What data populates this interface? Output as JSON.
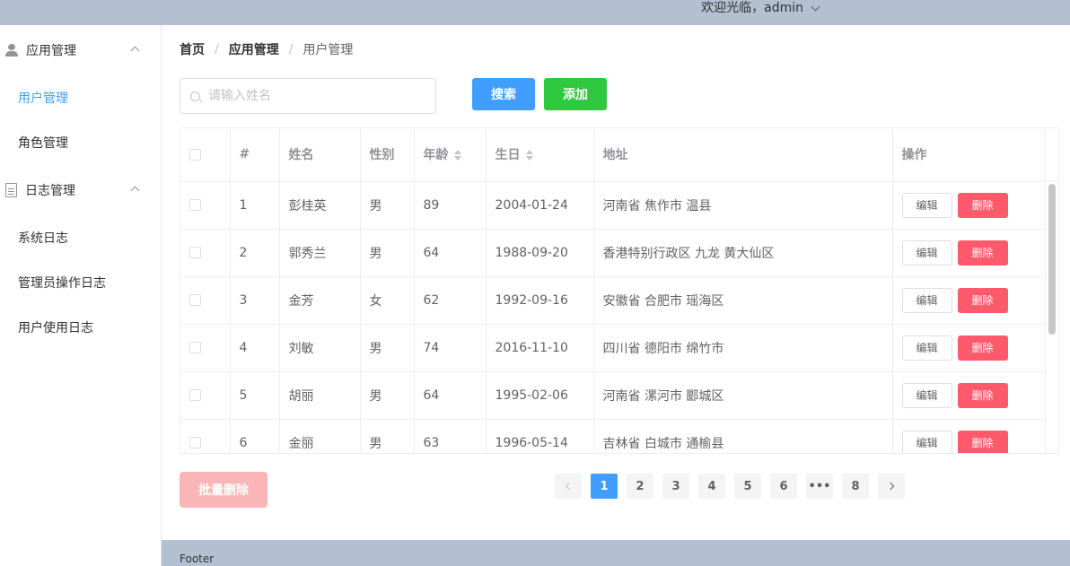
{
  "header": {
    "welcome": "欢迎光临，admin"
  },
  "sidebar": {
    "groups": [
      {
        "label": "应用管理",
        "icon": "user-icon",
        "items": [
          {
            "label": "用户管理",
            "active": true
          },
          {
            "label": "角色管理"
          }
        ]
      },
      {
        "label": "日志管理",
        "icon": "document-icon",
        "items": [
          {
            "label": "系统日志"
          },
          {
            "label": "管理员操作日志"
          },
          {
            "label": "用户使用日志"
          }
        ]
      }
    ]
  },
  "breadcrumb": [
    "首页",
    "应用管理",
    "用户管理"
  ],
  "breadcrumb_separator": "/",
  "toolbar": {
    "search_placeholder": "请输入姓名",
    "search_label": "搜索",
    "add_label": "添加"
  },
  "table": {
    "columns": [
      "#",
      "姓名",
      "性别",
      "年龄",
      "生日",
      "地址",
      "操作"
    ],
    "edit_label": "编辑",
    "delete_label": "删除",
    "rows": [
      {
        "index": "1",
        "name": "彭桂英",
        "gender": "男",
        "age": "89",
        "birthday": "2004-01-24",
        "address": "河南省 焦作市 温县"
      },
      {
        "index": "2",
        "name": "郭秀兰",
        "gender": "男",
        "age": "64",
        "birthday": "1988-09-20",
        "address": "香港特别行政区 九龙 黄大仙区"
      },
      {
        "index": "3",
        "name": "金芳",
        "gender": "女",
        "age": "62",
        "birthday": "1992-09-16",
        "address": "安徽省 合肥市 瑶海区"
      },
      {
        "index": "4",
        "name": "刘敏",
        "gender": "男",
        "age": "74",
        "birthday": "2016-11-10",
        "address": "四川省 德阳市 绵竹市"
      },
      {
        "index": "5",
        "name": "胡丽",
        "gender": "男",
        "age": "64",
        "birthday": "1995-02-06",
        "address": "河南省 漯河市 郾城区"
      },
      {
        "index": "6",
        "name": "金丽",
        "gender": "男",
        "age": "63",
        "birthday": "1996-05-14",
        "address": "吉林省 白城市 通榆县"
      }
    ]
  },
  "batch_delete_label": "批量删除",
  "pagination": {
    "pages": [
      "1",
      "2",
      "3",
      "4",
      "5",
      "6",
      "•••",
      "8"
    ],
    "current": "1"
  },
  "footer": {
    "text": "Footer"
  },
  "colors": {
    "primary": "#409eff",
    "success": "#30c83f",
    "danger": "#fe5a6c",
    "danger_light": "#fab6b6",
    "header_bg": "#b3c0d1"
  }
}
